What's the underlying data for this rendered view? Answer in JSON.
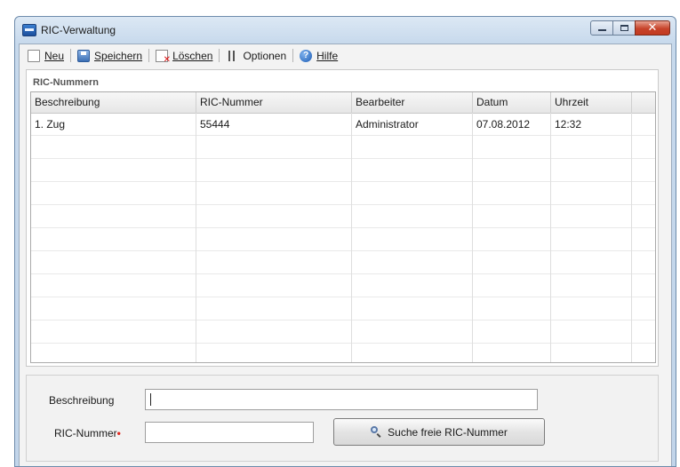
{
  "window": {
    "title": "RIC-Verwaltung"
  },
  "toolbar": {
    "new_label": "Neu",
    "save_label": "Speichern",
    "delete_label": "Löschen",
    "options_label": "Optionen",
    "help_label": "Hilfe"
  },
  "panel": {
    "title": "RIC-Nummern"
  },
  "table": {
    "headers": [
      "Beschreibung",
      "RIC-Nummer",
      "Bearbeiter",
      "Datum",
      "Uhrzeit"
    ],
    "rows": [
      [
        "1. Zug",
        "55444",
        "Administrator",
        "07.08.2012",
        "12:32"
      ]
    ]
  },
  "form": {
    "description_label": "Beschreibung",
    "description_value": "",
    "ric_label": "RIC-Nummer",
    "ric_required_marker": "•",
    "ric_value": "",
    "search_button_label": "Suche freie RIC-Nummer"
  },
  "colors": {
    "required_marker": "#e0281f",
    "close_button": "#c7432a"
  },
  "icons": [
    "app-icon",
    "minimize-icon",
    "maximize-icon",
    "close-icon",
    "new-icon",
    "save-icon",
    "delete-icon",
    "options-icon",
    "help-icon",
    "search-icon"
  ]
}
